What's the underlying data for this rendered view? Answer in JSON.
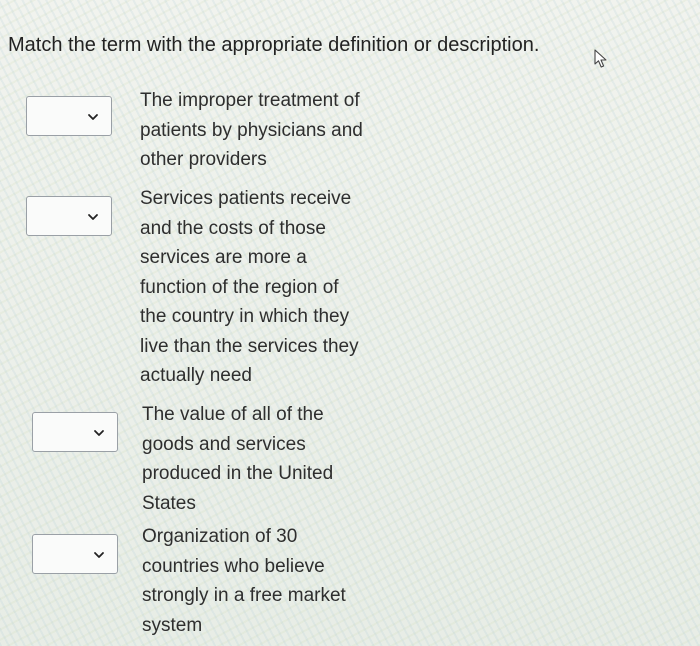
{
  "question": {
    "prompt": "Match the term with the appropriate definition or description."
  },
  "items": [
    {
      "selected": "",
      "lines": [
        "The improper treatment of",
        "patients by physicians and",
        "other providers"
      ]
    },
    {
      "selected": "",
      "lines": [
        "Services patients receive",
        "and the costs of those",
        "services are more a",
        "function of the region of",
        "the country in which they",
        "live than the services they",
        "actually need"
      ]
    },
    {
      "selected": "",
      "lines": [
        "The value of all of the",
        "goods and services",
        "produced in the United",
        "States"
      ]
    },
    {
      "selected": "",
      "lines": [
        "Organization of 30",
        "countries who believe",
        "strongly in a free market",
        "system"
      ]
    }
  ],
  "icons": {
    "dropdown": "chevron-down-icon",
    "cursor": "mouse-pointer-icon"
  },
  "colors": {
    "text": "#2e2e2e",
    "border": "#9aa0a6",
    "background": "#eef1ea"
  }
}
